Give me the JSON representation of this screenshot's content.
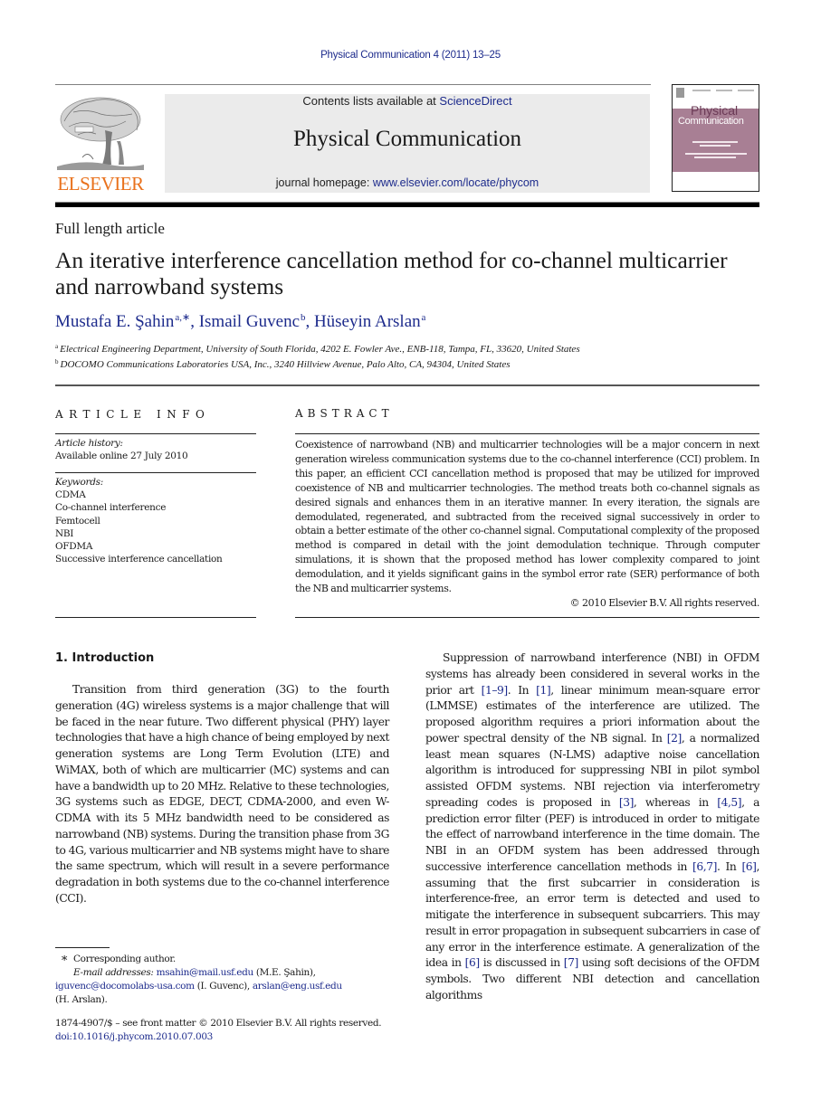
{
  "running_head": "Physical Communication 4 (2011) 13–25",
  "header": {
    "publisher_wordmark": "ELSEVIER",
    "publisher_logo_icon": "elsevier-tree-icon",
    "contents_prefix": "Contents lists available at ",
    "contents_link": "ScienceDirect",
    "journal_title": "Physical Communication",
    "homepage_prefix": "journal homepage: ",
    "homepage_link": "www.elsevier.com/locate/phycom",
    "cover": {
      "title_line1": "Physical",
      "title_line2": "Communication",
      "accent_color": "#a87f94"
    },
    "publisher_color": "#e9711c",
    "link_color": "#1d2b8c"
  },
  "article": {
    "type": "Full length article",
    "title": "An iterative interference cancellation method for co-channel multicarrier and narrowband systems",
    "authors": [
      {
        "name": "Mustafa E. Şahin",
        "affil": "a,∗"
      },
      {
        "name": "Ismail Guvenc",
        "affil": "b"
      },
      {
        "name": "Hüseyin Arslan",
        "affil": "a"
      }
    ],
    "affiliations": [
      {
        "key": "a",
        "text": "Electrical Engineering Department, University of South Florida, 4202 E. Fowler Ave., ENB-118, Tampa, FL, 33620, United States"
      },
      {
        "key": "b",
        "text": "DOCOMO Communications Laboratories USA, Inc., 3240 Hillview Avenue, Palo Alto, CA, 94304, United States"
      }
    ]
  },
  "article_info": {
    "heading": "ARTICLE INFO",
    "history_label": "Article history:",
    "history_value": "Available online 27 July 2010",
    "keywords_label": "Keywords:",
    "keywords": [
      "CDMA",
      "Co-channel interference",
      "Femtocell",
      "NBI",
      "OFDMA",
      "Successive interference cancellation"
    ]
  },
  "abstract": {
    "heading": "ABSTRACT",
    "text": "Coexistence of narrowband (NB) and multicarrier technologies will be a major concern in next generation wireless communication systems due to the co-channel interference (CCI) problem. In this paper, an efficient CCI cancellation method is proposed that may be utilized for improved coexistence of NB and multicarrier technologies. The method treats both co-channel signals as desired signals and enhances them in an iterative manner. In every iteration, the signals are demodulated, regenerated, and subtracted from the received signal successively in order to obtain a better estimate of the other co-channel signal. Computational complexity of the proposed method is compared in detail with the joint demodulation technique. Through computer simulations, it is shown that the proposed method has lower complexity compared to joint demodulation, and it yields significant gains in the symbol error rate (SER) performance of both the NB and multicarrier systems.",
    "copyright": "© 2010 Elsevier B.V. All rights reserved."
  },
  "introduction": {
    "heading": "1.  Introduction",
    "left_paragraph": "Transition from third generation (3G) to the fourth generation (4G) wireless systems is a major challenge that will be faced in the near future. Two different physical (PHY) layer technologies that have a high chance of being employed by next generation systems are Long Term Evolution (LTE) and WiMAX, both of which are multicarrier (MC) systems and can have a bandwidth up to 20 MHz. Relative to these technologies, 3G systems such as EDGE, DECT, CDMA-2000, and even W-CDMA with its 5 MHz bandwidth need to be considered as narrowband (NB) systems. During the transition phase from 3G to 4G, various multicarrier and NB systems might have to share the same spectrum, which will result in a severe performance degradation in both systems due to the co-channel interference (CCI).",
    "right_segments": [
      {
        "t": "Suppression of narrowband interference (NBI) in OFDM systems has already been considered in several works in the prior art "
      },
      {
        "t": "[1–9]",
        "ref": true
      },
      {
        "t": ". In "
      },
      {
        "t": "[1]",
        "ref": true
      },
      {
        "t": ", linear minimum mean-square error (LMMSE) estimates of the interference are utilized. The proposed algorithm requires a priori infor­mation about the power spectral density of the NB sig­nal.  In "
      },
      {
        "t": "[2]",
        "ref": true
      },
      {
        "t": ", a normalized least mean squares (N-LMS) adaptive noise cancellation algorithm is introduced for suppressing NBI in pilot symbol assisted OFDM systems. NBI rejection via interferometry spreading codes is pro­posed in "
      },
      {
        "t": "[3]",
        "ref": true
      },
      {
        "t": ", whereas in "
      },
      {
        "t": "[4,5]",
        "ref": true
      },
      {
        "t": ", a prediction error filter (PEF) is introduced in order to mitigate the effect of narrowband interference in the time domain. The NBI in an OFDM sys­tem has been addressed through successive interference cancellation methods in "
      },
      {
        "t": "[6,7]",
        "ref": true
      },
      {
        "t": ". In "
      },
      {
        "t": "[6]",
        "ref": true
      },
      {
        "t": ", assuming that the first subcarrier in consideration is interference-free, an error term is detected and used to mitigate the interference in subsequent subcarriers. This may result in error propaga­tion in subsequent subcarriers in case of any error in the interference estimate. A generalization of the idea in "
      },
      {
        "t": "[6]",
        "ref": true
      },
      {
        "t": " is discussed in "
      },
      {
        "t": "[7]",
        "ref": true
      },
      {
        "t": " using soft decisions of the OFDM symbols. Two different NBI detection and cancellation algorithms"
      }
    ]
  },
  "footnotes": {
    "star": "∗",
    "corresponding": "Corresponding author.",
    "email_label": "E-mail addresses:",
    "emails": [
      {
        "address": "msahin@mail.usf.edu",
        "owner": "(M.E. Şahin),"
      },
      {
        "address": "iguvenc@docomolabs-usa.com",
        "owner": "(I. Guvenc),"
      },
      {
        "address": "arslan@eng.usf.edu",
        "owner": "(H. Arslan)."
      }
    ],
    "issn_line": "1874-4907/$ – see front matter © 2010 Elsevier B.V. All rights reserved.",
    "doi": "doi:10.1016/j.phycom.2010.07.003"
  }
}
